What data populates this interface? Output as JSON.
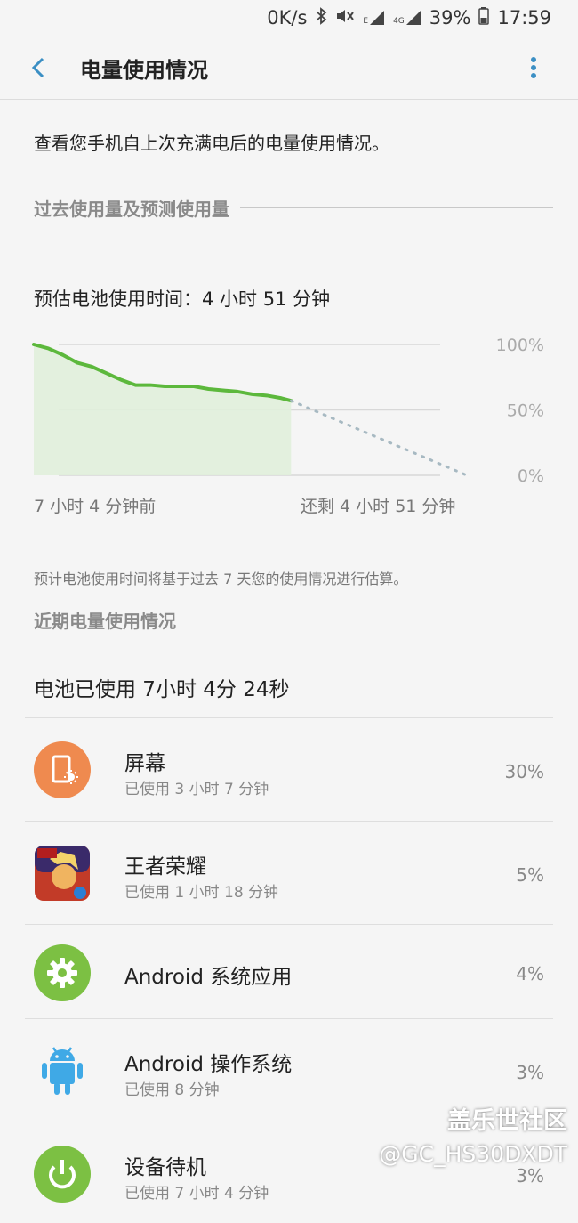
{
  "status_bar": {
    "speed": "0K/s",
    "signal_label_1": "E",
    "signal_label_2": "4G",
    "battery": "39%",
    "time": "17:59"
  },
  "header": {
    "title": "电量使用情况"
  },
  "description": "查看您手机自上次充满电后的电量使用情况。",
  "section_past": "过去使用量及预测使用量",
  "estimate_text": "预估电池使用时间：4 小时 51 分钟",
  "chart_data": {
    "type": "area",
    "x_start_label": "7 小时 4 分钟前",
    "x_end_label": "还剩 4 小时 51 分钟",
    "y_ticks": [
      "100%",
      "50%",
      "0%"
    ],
    "ylim": [
      0,
      100
    ],
    "xlim": [
      0,
      11.9
    ],
    "grid": true,
    "history_x": [
      0,
      0.4,
      0.8,
      1.2,
      1.6,
      2.0,
      2.4,
      2.8,
      3.2,
      3.6,
      4.0,
      4.4,
      4.8,
      5.2,
      5.6,
      6.0,
      6.4,
      6.8,
      7.07
    ],
    "history_y": [
      100,
      97,
      92,
      86,
      83,
      78,
      73,
      69,
      69,
      68,
      68,
      68,
      66,
      65,
      64,
      62,
      61,
      59,
      57
    ],
    "predicted_x": [
      7.07,
      11.9
    ],
    "predicted_y": [
      57,
      0
    ],
    "colors": {
      "line": "#5cb83c",
      "fill": "#e1f0dc",
      "predicted": "#a7b9c2",
      "grid": "#d8d8d8"
    }
  },
  "note": "预计电池使用时间将基于过去 7 天您的使用情况进行估算。",
  "section_recent": "近期电量使用情况",
  "battery_used": "电池已使用 7小时 4分 24秒",
  "items": [
    {
      "name": "屏幕",
      "sub": "已使用 3 小时 7 分钟",
      "percent": "30%",
      "icon": "screen-brightness-icon",
      "color": "#ef8a4f"
    },
    {
      "name": "王者荣耀",
      "sub": "已使用 1 小时 18 分钟",
      "percent": "5%",
      "icon": "game-app-icon",
      "color": "#c23b28"
    },
    {
      "name": "Android 系统应用",
      "sub": "",
      "percent": "4%",
      "icon": "gear-icon",
      "color": "#7cc043"
    },
    {
      "name": "Android 操作系统",
      "sub": "已使用 8 分钟",
      "percent": "3%",
      "icon": "android-icon",
      "color": "#3fa9e6"
    },
    {
      "name": "设备待机",
      "sub": "已使用 7 小时 4 分钟",
      "percent": "3%",
      "icon": "power-icon",
      "color": "#7cc043"
    }
  ],
  "watermark": {
    "line1": "盖乐世社区",
    "line2": "@GC_HS30DXDT"
  }
}
